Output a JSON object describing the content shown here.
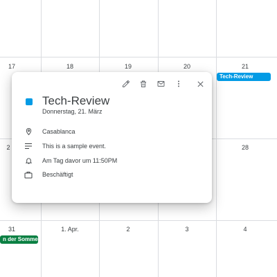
{
  "calendar": {
    "row1_days": [
      "17",
      "18",
      "19",
      "20",
      "21"
    ],
    "row2_days": [
      "",
      "",
      "",
      "",
      "28"
    ],
    "row2_first_day": "2",
    "row3_days": [
      "31",
      "1. Apr.",
      "2",
      "3",
      "4"
    ],
    "events": {
      "tech_review_chip": {
        "label": "Tech-Review",
        "color": "#039be5"
      },
      "summer_chip": {
        "label": "n der Sommer",
        "color": "#0b8043"
      }
    }
  },
  "popup": {
    "toolbar": {
      "edit_icon": "pencil-icon",
      "delete_icon": "trash-icon",
      "email_icon": "envelope-icon",
      "more_icon": "vertical-dots-icon",
      "close_icon": "close-icon"
    },
    "event_color": "#039be5",
    "title": "Tech-Review",
    "date": "Donnerstag, 21. März",
    "location": "Casablanca",
    "description": "This is a sample event.",
    "reminder": "Am Tag davor um 11:50PM",
    "availability": "Beschäftigt"
  }
}
